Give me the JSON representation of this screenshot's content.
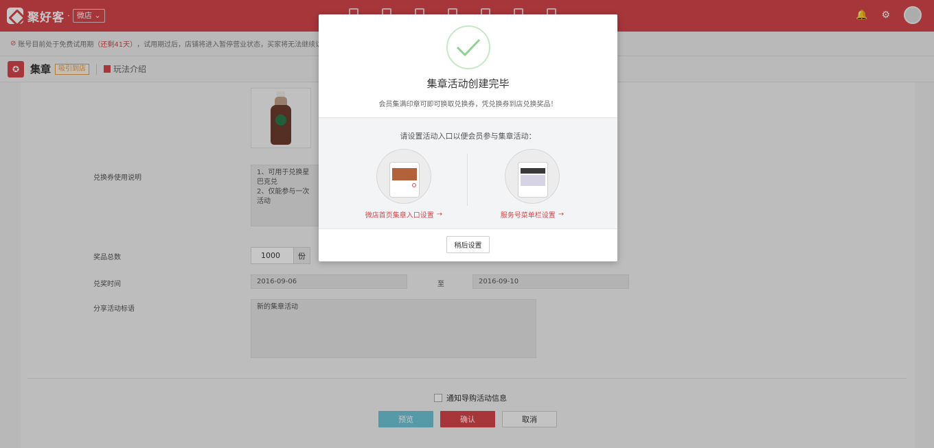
{
  "topbar": {
    "brand": "聚好客",
    "store_switch": "微店",
    "nav_icons": [
      "home-icon",
      "gift-icon",
      "list-icon",
      "store-icon",
      "user-icon",
      "chart-icon",
      "apps-icon"
    ]
  },
  "notice": {
    "prefix": "账号目前处于免费试用期",
    "remaining": "（还剩41天）",
    "suffix": "，试用期过后，店铺将进入暂停营业状态，买家将无法继续访问您的店铺"
  },
  "page": {
    "title": "集章",
    "tag": "吸引到店",
    "play_intro": "玩法介绍"
  },
  "form": {
    "voucher_label": "兑换券使用说明",
    "voucher_text_1": "1、可用于兑换星巴克兑",
    "voucher_text_2": "2、仅能参与一次活动",
    "prize_total_label": "奖品总数",
    "prize_total_value": "1000",
    "prize_unit": "份",
    "redeem_time_label": "兑奖时间",
    "date_start": "2016-09-06",
    "date_to": "至",
    "date_end": "2016-09-10",
    "share_title_label": "分享活动标语",
    "share_title_value": "新的集章活动",
    "notify_label": "通知导购活动信息",
    "preview_btn": "预览",
    "confirm_btn": "确认",
    "cancel_btn": "取消"
  },
  "modal": {
    "title": "集章活动创建完毕",
    "desc": "会员集满印章可即可换取兑换券，凭兑换券到店兑换奖品！",
    "hint": "请设置活动入口以便会员参与集章活动：",
    "entry_left": "微店首页集章入口设置",
    "entry_right": "服务号菜单栏设置",
    "later_btn": "稍后设置"
  }
}
